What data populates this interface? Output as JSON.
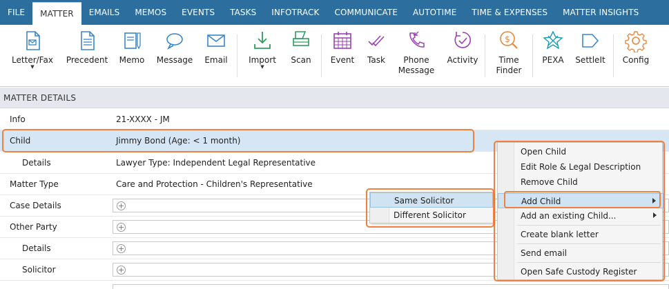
{
  "tabs": [
    {
      "label": "FILE",
      "active": false
    },
    {
      "label": "MATTER",
      "active": true
    },
    {
      "label": "EMAILS",
      "active": false
    },
    {
      "label": "MEMOS",
      "active": false
    },
    {
      "label": "EVENTS",
      "active": false
    },
    {
      "label": "TASKS",
      "active": false
    },
    {
      "label": "INFOTRACK",
      "active": false
    },
    {
      "label": "COMMUNICATE",
      "active": false
    },
    {
      "label": "AUTOTIME",
      "active": false
    },
    {
      "label": "TIME & EXPENSES",
      "active": false
    },
    {
      "label": "MATTER INSIGHTS",
      "active": false
    }
  ],
  "ribbon": {
    "letter_fax": {
      "label": "Letter/Fax",
      "icon": "letter-icon"
    },
    "precedent": {
      "label": "Precedent",
      "icon": "document-icon"
    },
    "memo": {
      "label": "Memo",
      "icon": "memo-icon"
    },
    "message": {
      "label": "Message",
      "icon": "message-icon"
    },
    "email": {
      "label": "Email",
      "icon": "envelope-icon"
    },
    "import": {
      "label": "Import",
      "icon": "download-icon"
    },
    "scan": {
      "label": "Scan",
      "icon": "scanner-icon"
    },
    "event": {
      "label": "Event",
      "icon": "calendar-icon"
    },
    "task": {
      "label": "Task",
      "icon": "checkmark-icon"
    },
    "phone_message": {
      "line1": "Phone",
      "line2": "Message",
      "icon": "phone-icon"
    },
    "activity": {
      "label": "Activity",
      "icon": "activity-icon"
    },
    "time_finder": {
      "line1": "Time",
      "line2": "Finder",
      "icon": "time-finder-icon"
    },
    "pexa": {
      "label": "PEXA",
      "icon": "pexa-icon"
    },
    "settleit": {
      "label": "SettleIt",
      "icon": "arrow-right-icon"
    },
    "config": {
      "label": "Config",
      "icon": "gear-icon"
    }
  },
  "colors": {
    "tabbar": "#2c6f9e",
    "accent_blue": "#3a86c8",
    "purple": "#9b3fb5",
    "green": "#2f9d5f",
    "orange": "#e8873a",
    "highlight": "#f0803c"
  },
  "section": {
    "title": "MATTER DETAILS"
  },
  "rows": [
    {
      "label": "Info",
      "value": "21-XXXX - JM"
    },
    {
      "label": "Child",
      "value": "Jimmy Bond (Age: < 1 month)"
    },
    {
      "label": "Details",
      "value": "Lawyer Type: Independent Legal Representative"
    },
    {
      "label": "Matter Type",
      "value": "Care and Protection - Children's Representative"
    },
    {
      "label": "Case Details"
    },
    {
      "label": "Other Party"
    },
    {
      "label": "Details"
    },
    {
      "label": "Solicitor"
    }
  ],
  "context_menu": {
    "items": [
      {
        "label": "Open Child"
      },
      {
        "label": "Edit Role & Legal Description"
      },
      {
        "label": "Remove Child"
      },
      {
        "label": "Add Child"
      },
      {
        "label": "Add an existing Child..."
      },
      {
        "label": "Create blank letter"
      },
      {
        "label": "Send email"
      },
      {
        "label": "Open Safe Custody Register"
      }
    ]
  },
  "submenu": {
    "items": [
      {
        "label": "Same Solicitor"
      },
      {
        "label": "Different Solicitor"
      }
    ]
  }
}
